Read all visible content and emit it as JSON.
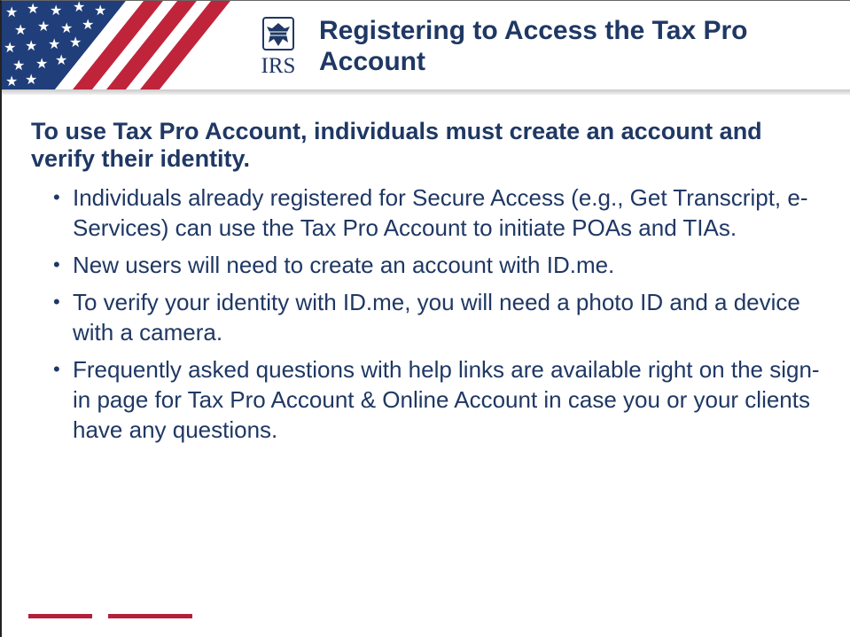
{
  "header": {
    "title": "Registering to Access the Tax Pro Account",
    "logo_text": "IRS",
    "flag_icon": "us-flag-banner-icon",
    "logo_icon": "irs-eagle-logo-icon"
  },
  "content": {
    "subheading": "To use Tax Pro Account, individuals must create an account and verify their identity.",
    "bullets": [
      "Individuals already registered for Secure Access (e.g., Get Transcript, e-Services) can use the Tax Pro Account to initiate POAs and TIAs.",
      "New users will need to create an account with ID.me.",
      "To verify your identity with ID.me, you will need a photo ID and a device with a camera.",
      "Frequently asked questions with help links are available right on the sign-in page for Tax Pro Account & Online Account in case you or your clients have any questions."
    ],
    "bullet_glyph": "•"
  },
  "colors": {
    "title": "#1f3864",
    "accent_red": "#b41f3a",
    "flag_blue": "#1f3e7a",
    "flag_red": "#c0243b"
  }
}
